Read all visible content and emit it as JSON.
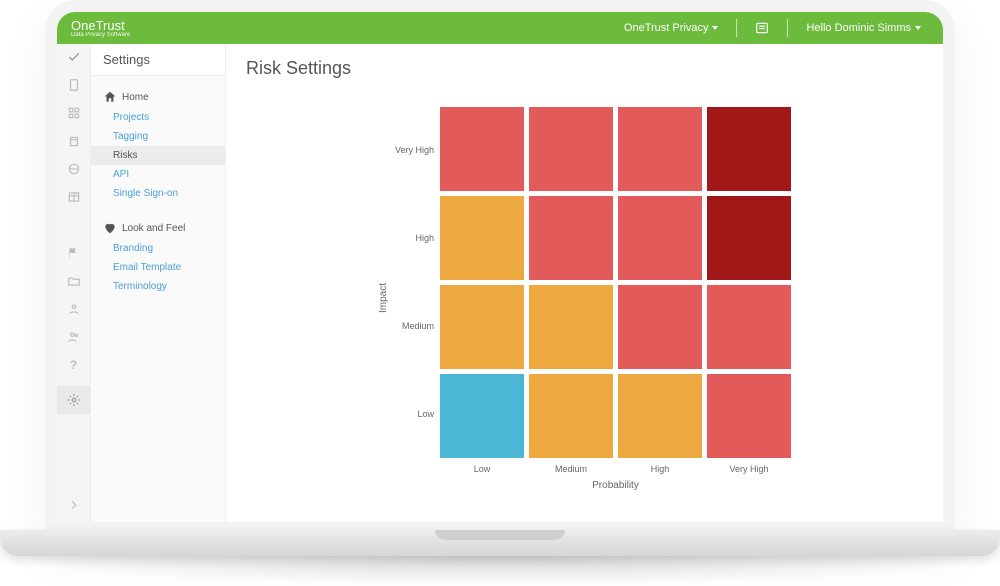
{
  "brand": {
    "name": "OneTrust",
    "tagline": "Data Privacy Software"
  },
  "topbar": {
    "app_switcher": "OneTrust Privacy",
    "greeting": "Hello Dominic Simms"
  },
  "section_title": "Settings",
  "sidebar": {
    "groups": [
      {
        "label": "Home",
        "icon": "home-icon",
        "items": [
          {
            "label": "Projects"
          },
          {
            "label": "Tagging"
          },
          {
            "label": "Risks",
            "selected": true
          },
          {
            "label": "API"
          },
          {
            "label": "Single Sign-on"
          }
        ]
      },
      {
        "label": "Look and Feel",
        "icon": "heart-icon",
        "items": [
          {
            "label": "Branding"
          },
          {
            "label": "Email Template"
          },
          {
            "label": "Terminology"
          }
        ]
      }
    ]
  },
  "page": {
    "title": "Risk Settings"
  },
  "chart_data": {
    "type": "heatmap",
    "title": "Risk Settings",
    "xlabel": "Probability",
    "ylabel": "Impact",
    "x_categories": [
      "Low",
      "Medium",
      "High",
      "Very High"
    ],
    "y_categories": [
      "Very High",
      "High",
      "Medium",
      "Low"
    ],
    "color_scale": {
      "1": "#4cb6d6",
      "2": "#eda93f",
      "3": "#e35a5a",
      "4": "#a21818"
    },
    "values": [
      [
        3,
        3,
        3,
        4
      ],
      [
        2,
        3,
        3,
        4
      ],
      [
        2,
        2,
        3,
        3
      ],
      [
        1,
        2,
        2,
        3
      ]
    ]
  }
}
